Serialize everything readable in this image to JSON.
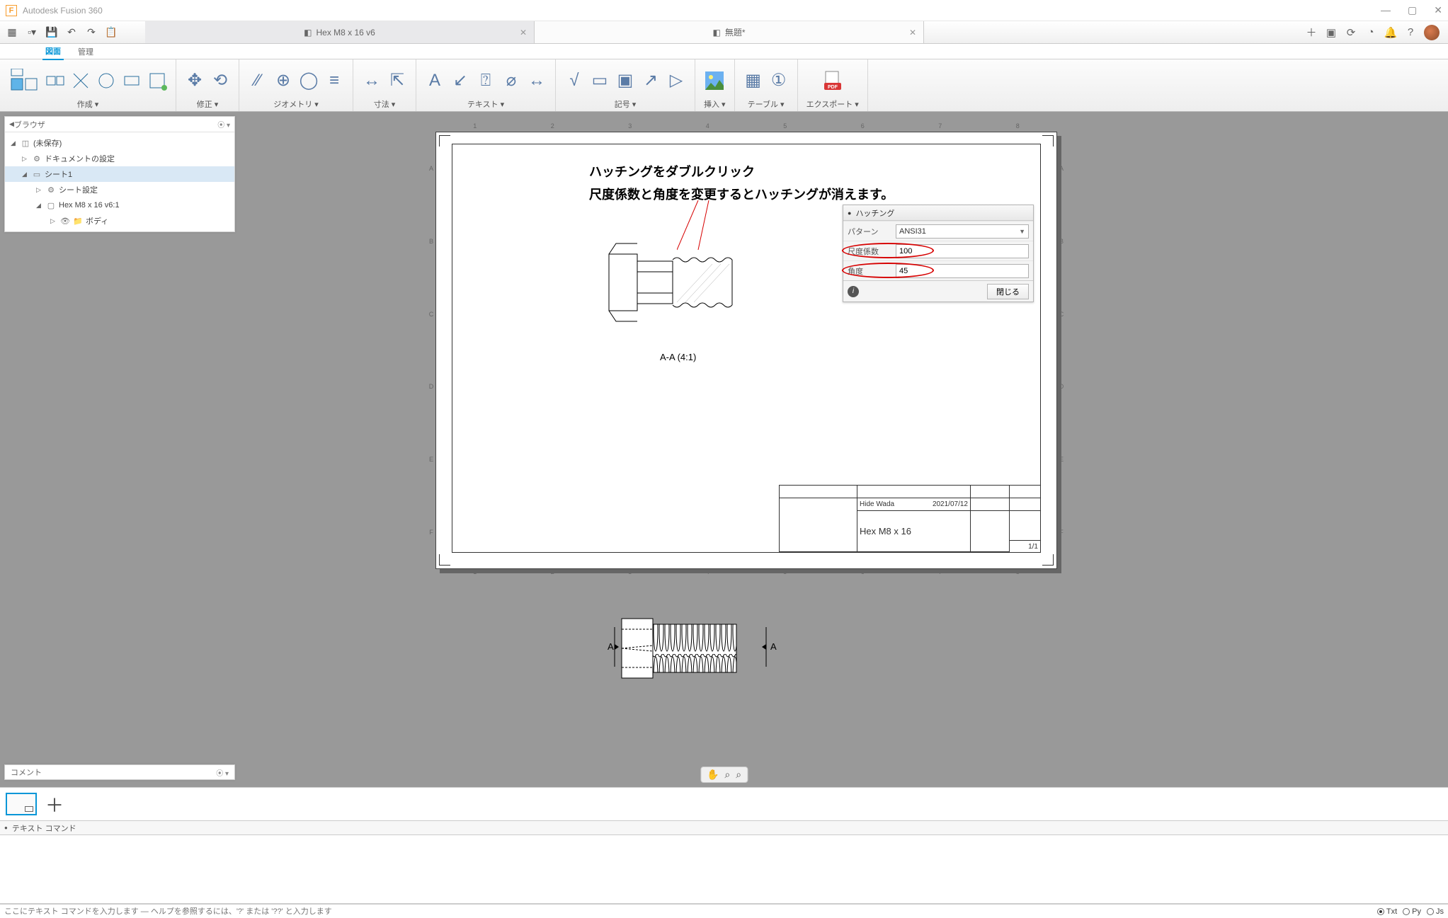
{
  "title": "Autodesk Fusion 360",
  "tabs": [
    {
      "label": "Hex M8 x 16 v6",
      "active": false
    },
    {
      "label": "無題*",
      "active": true
    }
  ],
  "workspace": {
    "active": "図面",
    "other": "管理"
  },
  "ribbon": {
    "create": "作成 ▾",
    "modify": "修正 ▾",
    "geometry": "ジオメトリ ▾",
    "dimension": "寸法 ▾",
    "text": "テキスト ▾",
    "symbol": "記号 ▾",
    "insert": "挿入 ▾",
    "table": "テーブル ▾",
    "export": "エクスポート ▾"
  },
  "browser": {
    "title": "ブラウザ",
    "root": "(未保存)",
    "items": [
      "ドキュメントの設定",
      "シート1",
      "シート設定",
      "Hex M8 x 16 v6:1",
      "ボディ"
    ]
  },
  "annotation": {
    "line1": "ハッチングをダブルクリック",
    "line2": "尺度係数と角度を変更するとハッチングが消えます。"
  },
  "view_label": "A-A (4:1)",
  "hatch": {
    "title": "ハッチング",
    "pattern_label": "パターン",
    "pattern_value": "ANSI31",
    "scale_label": "尺度係数",
    "scale_value": "100",
    "angle_label": "角度",
    "angle_value": "45",
    "close": "閉じる"
  },
  "titleblock": {
    "author": "Hide Wada",
    "date": "2021/07/12",
    "partname": "Hex M8 x 16",
    "sheet": "1/1"
  },
  "section_marks": {
    "left": "A",
    "right": "A"
  },
  "comment_label": "コメント",
  "textcmd": {
    "title": "テキスト コマンド",
    "placeholder": "ここにテキスト コマンドを入力します — ヘルプを参照するには、'?' または '??' と入力します",
    "radios": [
      "Txt",
      "Py",
      "Js"
    ]
  }
}
